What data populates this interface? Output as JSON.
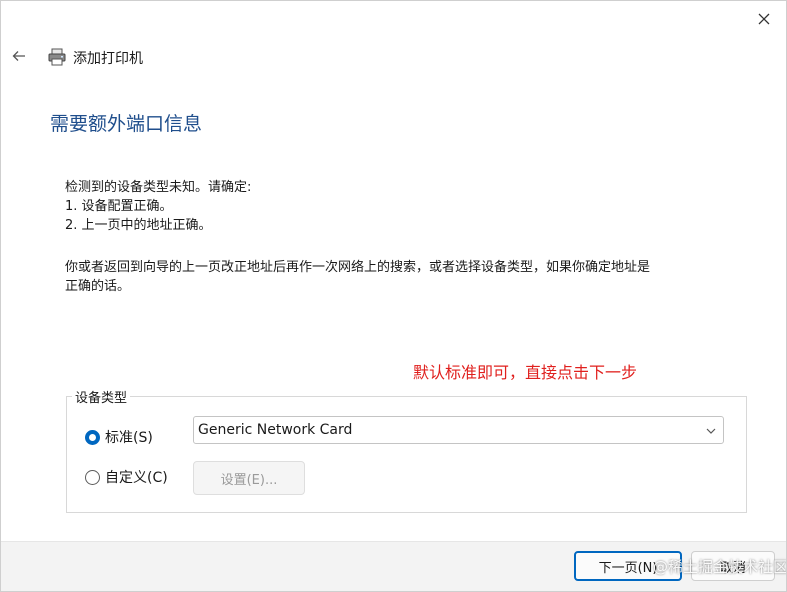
{
  "window": {
    "title": "添加打印机"
  },
  "page": {
    "heading": "需要额外端口信息",
    "intro": "检测到的设备类型未知。请确定:",
    "item1": "1. 设备配置正确。",
    "item2": "2. 上一页中的地址正确。",
    "para_line1": "你或者返回到向导的上一页改正地址后再作一次网络上的搜索，或者选择设备类型，如果你确定地址是",
    "para_line2": "正确的话。"
  },
  "annotation": "默认标准即可，直接点击下一步",
  "device_type": {
    "legend": "设备类型",
    "standard_label": "标准(S)",
    "custom_label": "自定义(C)",
    "selected_value": "Generic Network Card",
    "settings_label": "设置(E)..."
  },
  "footer": {
    "next_label": "下一页(N)",
    "cancel_label": "取消"
  },
  "watermark": "@稀土掘金技术社区",
  "colors": {
    "heading": "#1f4e8c",
    "annotation": "#e0201e",
    "accent": "#0067c0"
  }
}
